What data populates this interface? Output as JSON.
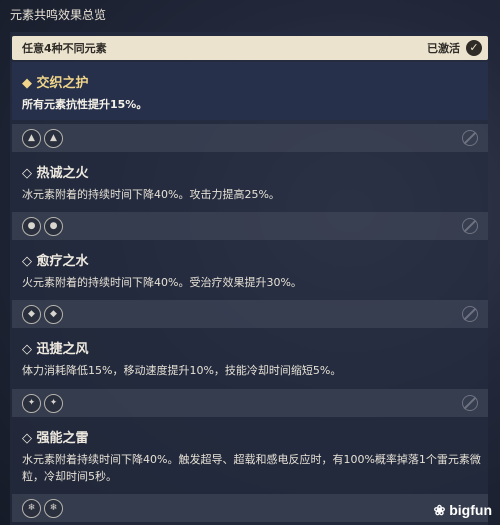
{
  "header": {
    "title": "元素共鸣效果总览"
  },
  "active_bar": {
    "condition": "任意4种不同元素",
    "status": "已激活",
    "check_icon": "check-circle-icon"
  },
  "active_effect": {
    "name": "◆ 交织之护",
    "description": "所有元素抗性提升15%。"
  },
  "resonances": [
    {
      "icons": [
        "pyro-icon",
        "pyro-icon"
      ],
      "name": "◇ 热诚之火",
      "description": "冰元素附着的持续时间下降40%。攻击力提高25%。"
    },
    {
      "icons": [
        "hydro-icon",
        "hydro-icon"
      ],
      "name": "◇ 愈疗之水",
      "description": "火元素附着的持续时间下降40%。受治疗效果提升30%。"
    },
    {
      "icons": [
        "anemo-icon",
        "anemo-icon"
      ],
      "name": "◇ 迅捷之风",
      "description": "体力消耗降低15%，移动速度提升10%，技能冷却时间缩短5%。"
    },
    {
      "icons": [
        "electro-icon",
        "electro-icon"
      ],
      "name": "◇ 强能之雷",
      "description": "水元素附着持续时间下降40%。触发超导、超载和感电反应时，有100%概率掉落1个雷元素微粒，冷却时间5秒。"
    },
    {
      "icons": [
        "cryo-icon",
        "cryo-icon"
      ]
    }
  ],
  "watermark": "bigfun"
}
